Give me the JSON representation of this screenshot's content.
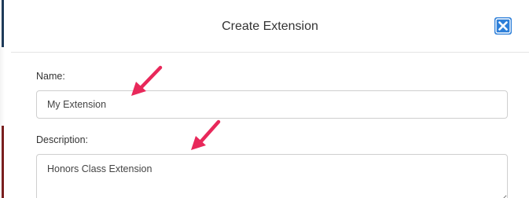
{
  "modal": {
    "title": "Create Extension",
    "close_icon": "close-icon",
    "accent_color": "#2d7fd9"
  },
  "form": {
    "name": {
      "label": "Name:",
      "value": "My Extension"
    },
    "description": {
      "label": "Description:",
      "value": "Honors Class Extension"
    }
  },
  "annotations": {
    "arrow_icon": "arrow-icon",
    "arrow_color": "#e8285a"
  }
}
